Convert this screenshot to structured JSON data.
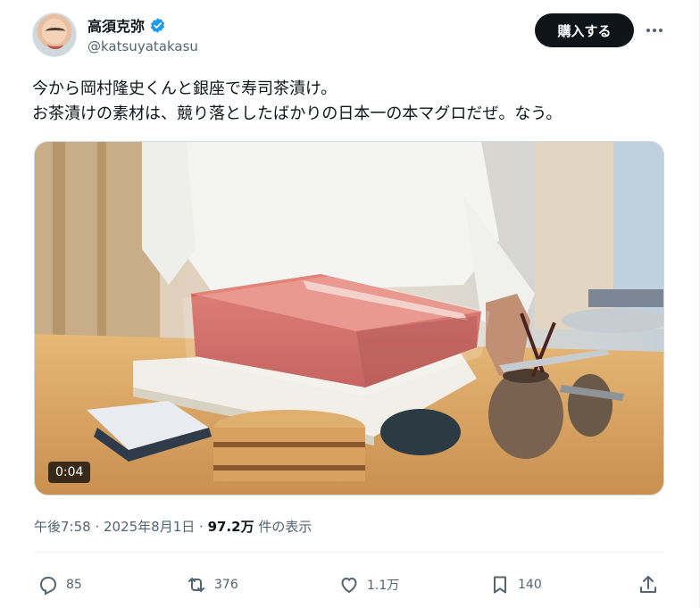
{
  "author": {
    "display_name": "高須克弥",
    "handle": "@katsuyatakasu",
    "verified": true
  },
  "header": {
    "buy_label": "購入する",
    "more_icon": "more-horizontal-icon"
  },
  "post": {
    "lines": [
      "今から岡村隆史くんと銀座で寿司茶漬け。",
      "お茶漬けの素材は、競り落としたばかりの日本一の本マグロだぜ。なう。"
    ]
  },
  "media": {
    "video_timestamp": "0:04",
    "description_icon": "video-thumbnail"
  },
  "meta": {
    "time": "午後7:58",
    "separator1": " · ",
    "date": "2025年8月1日",
    "separator2": " · ",
    "views": "97.2万",
    "views_label": " 件の表示"
  },
  "actions": {
    "replies": "85",
    "reposts": "376",
    "likes": "1.1万",
    "bookmarks": "140"
  },
  "colors": {
    "text_primary": "#0f1419",
    "text_secondary": "#536471",
    "verified_blue": "#1d9bf0",
    "button_bg": "#0f1419"
  }
}
